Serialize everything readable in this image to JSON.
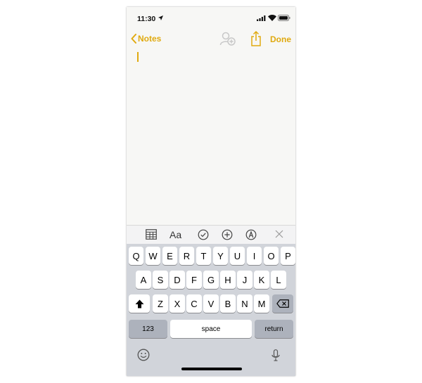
{
  "colors": {
    "accent": "#e0aa10",
    "key": "#ffffff",
    "key_dark": "#adb2bc",
    "keyboard_bg": "#d1d4da"
  },
  "status_bar": {
    "time": "11:30"
  },
  "nav": {
    "back_label": "Notes",
    "done_label": "Done"
  },
  "toolbar": {
    "format_label": "Aa"
  },
  "keyboard": {
    "row1": [
      "Q",
      "W",
      "E",
      "R",
      "T",
      "Y",
      "U",
      "I",
      "O",
      "P"
    ],
    "row2": [
      "A",
      "S",
      "D",
      "F",
      "G",
      "H",
      "J",
      "K",
      "L"
    ],
    "row3": [
      "Z",
      "X",
      "C",
      "V",
      "B",
      "N",
      "M"
    ],
    "numbers_label": "123",
    "space_label": "space",
    "return_label": "return"
  }
}
